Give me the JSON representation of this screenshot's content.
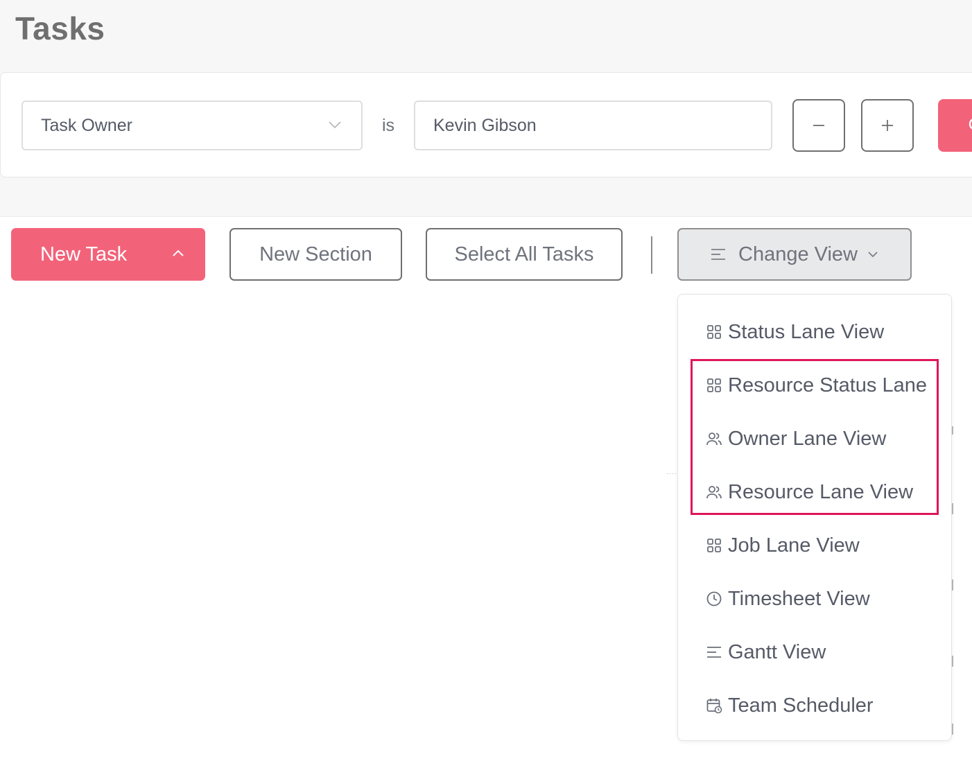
{
  "page": {
    "title": "Tasks"
  },
  "filter": {
    "field_label": "Task Owner",
    "operator": "is",
    "value": "Kevin Gibson"
  },
  "toolbar": {
    "new_task_label": "New Task",
    "new_section_label": "New Section",
    "select_all_label": "Select All Tasks",
    "change_view_label": "Change View"
  },
  "view_menu": {
    "items": [
      {
        "label": "Status Lane View",
        "icon": "grid-icon"
      },
      {
        "label": "Resource Status Lane",
        "icon": "grid-icon"
      },
      {
        "label": "Owner Lane View",
        "icon": "users-icon"
      },
      {
        "label": "Resource Lane View",
        "icon": "users-icon"
      },
      {
        "label": "Job Lane View",
        "icon": "grid-icon"
      },
      {
        "label": "Timesheet View",
        "icon": "clock-icon"
      },
      {
        "label": "Gantt View",
        "icon": "lines-icon"
      },
      {
        "label": "Team Scheduler",
        "icon": "calendar-clock-icon"
      }
    ]
  },
  "colors": {
    "accent": "#f2637a",
    "highlight": "#e0155a"
  }
}
